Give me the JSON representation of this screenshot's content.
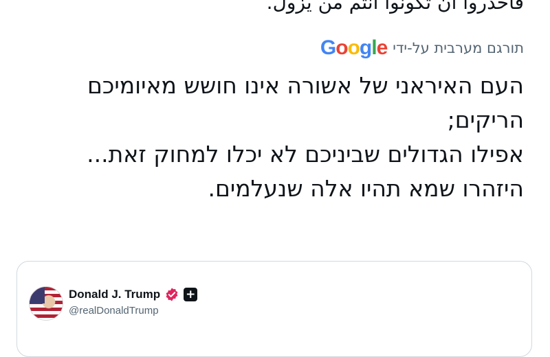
{
  "tweet": {
    "cut_off_text": "فاحذروا ان تكونوا انتم من يزول.",
    "translated_label": "תורגם מערבית על-ידי",
    "translation_provider": {
      "name": "Google",
      "letters": [
        "G",
        "o",
        "o",
        "g",
        "l",
        "e"
      ],
      "colors": [
        "#4285F4",
        "#EA4335",
        "#FBBC05",
        "#4285F4",
        "#34A853",
        "#EA4335"
      ]
    },
    "lines": [
      "העם האיראני של אשורה אינו חושש מאיומיכם",
      "הריקים;",
      "אפילו הגדולים שביניכם לא יכלו למחוק זאת...",
      "היזהרו שמא תהיו אלה שנעלמים."
    ]
  },
  "quoted_tweet": {
    "author_name": "Donald J. Trump",
    "handle": "@realDonaldTrump",
    "verified_color": "#e0245e"
  }
}
